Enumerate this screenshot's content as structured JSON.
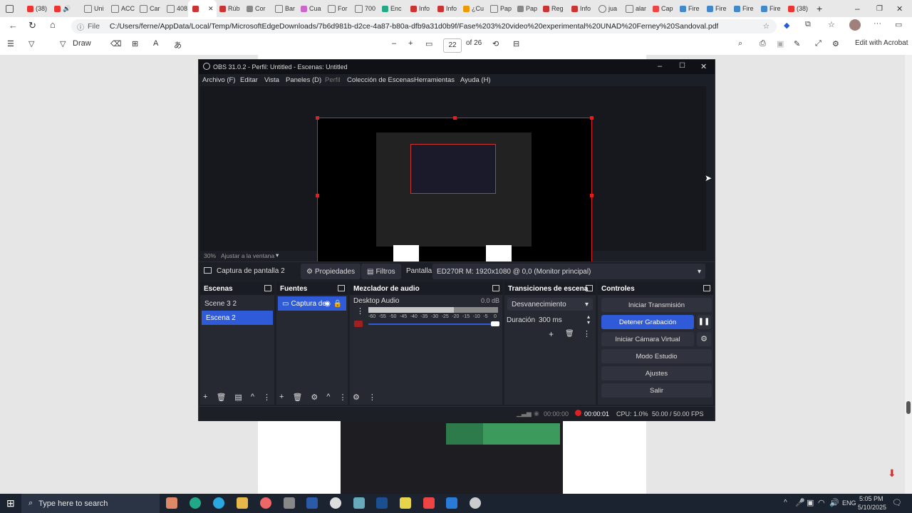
{
  "browser": {
    "tabs": [
      "(38)",
      "",
      "Uni",
      "ACC",
      "Car",
      "408",
      "",
      "Rúb",
      "Cor",
      "Bar",
      "Cua",
      "For",
      "700",
      "Enc",
      "Info",
      "Info",
      "¿Cu",
      "Pap",
      "Pap",
      "Reg",
      "Info",
      "jua",
      "alar",
      "Cap",
      "Fire",
      "Fire",
      "Fire",
      "Fire",
      "(38)"
    ],
    "address_label": "File",
    "url": "C:/Users/ferne/AppData/Local/Temp/MicrosoftEdgeDownloads/7b6d981b-d2ce-4a87-b80a-dfb9a31d0b9f/Fase%203%20video%20experimental%20UNAD%20Ferney%20Sandoval.pdf"
  },
  "pdf_toolbar": {
    "draw_label": "Draw",
    "page_current": "22",
    "page_total": "of 26",
    "edit_label": "Edit with Acrobat"
  },
  "obs": {
    "title": "OBS 31.0.2 - Perfil: Untitled - Escenas: Untitled",
    "menu": [
      "Archivo (F)",
      "Editar",
      "Vista",
      "Paneles (D)",
      "Perfil",
      "Colección de Escenas",
      "Herramientas",
      "Ayuda (H)"
    ],
    "zoom": "30%",
    "fit_label": "Ajustar a la ventana",
    "source_name": "Captura de pantalla 2",
    "properties_label": "Propiedades",
    "filters_label": "Filtros",
    "screen_label": "Pantalla",
    "monitor_value": "ED270R M: 1920x1080 @ 0,0 (Monitor principal)",
    "docks": {
      "scenes": {
        "title": "Escenas",
        "items": [
          "Scene 3 2",
          "Escena 2"
        ],
        "selected": "Escena 2"
      },
      "sources": {
        "title": "Fuentes",
        "items": [
          "Captura de"
        ]
      },
      "mixer": {
        "title": "Mezclador de audio",
        "track": "Desktop Audio",
        "db": "0.0 dB",
        "ticks": [
          "-60",
          "-55",
          "-50",
          "-45",
          "-40",
          "-35",
          "-30",
          "-25",
          "-20",
          "-15",
          "-10",
          "-5",
          "0"
        ]
      },
      "transitions": {
        "title": "Transiciones de escena",
        "type": "Desvanecimiento",
        "duration_label": "Duración",
        "duration_value": "300 ms"
      },
      "controls": {
        "title": "Controles",
        "buttons": [
          "Iniciar Transmisión",
          "Detener Grabación",
          "Iniciar Cámara Virtual",
          "Modo Estudio",
          "Ajustes",
          "Salir"
        ]
      }
    },
    "status": {
      "stream_time": "00:00:00",
      "rec_time": "00:00:01",
      "cpu": "CPU: 1.0%",
      "fps": "50.00 / 50.00 FPS"
    }
  },
  "taskbar": {
    "search_placeholder": "Type here to search",
    "lang": "ENG",
    "time": "5:05 PM",
    "date": "5/10/2025"
  },
  "colors": {
    "accent": "#2f5bd8",
    "rec_red": "#e02020"
  }
}
